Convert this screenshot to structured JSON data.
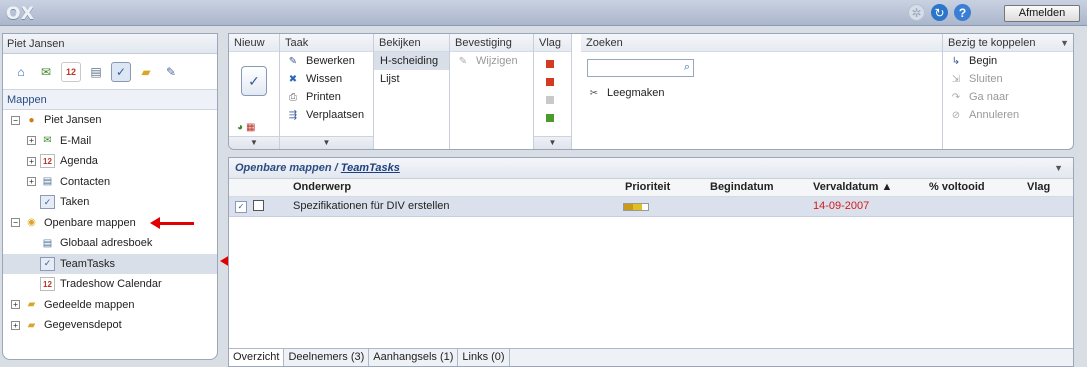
{
  "app": {
    "logo": "OX",
    "logout_label": "Afmelden",
    "user_name": "Piet Jansen"
  },
  "left": {
    "header": "Piet Jansen",
    "modules": [
      "portal-icon",
      "mail-icon",
      "calendar-icon",
      "contacts-icon",
      "tasks-icon",
      "files-icon",
      "notes-icon"
    ],
    "calendar_day": "12",
    "mappen_label": "Mappen",
    "tree": [
      {
        "label": "Piet Jansen",
        "expander": "−",
        "icon": "user-icon",
        "level": 0
      },
      {
        "label": "E-Mail",
        "expander": "+",
        "icon": "mail-folder-icon",
        "level": 1
      },
      {
        "label": "Agenda",
        "expander": "+",
        "icon": "calendar-folder-icon",
        "level": 1
      },
      {
        "label": "Contacten",
        "expander": "+",
        "icon": "contacts-folder-icon",
        "level": 1
      },
      {
        "label": "Taken",
        "expander": "",
        "icon": "tasks-folder-icon",
        "level": 1
      },
      {
        "label": "Openbare mappen",
        "expander": "−",
        "icon": "public-folder-icon",
        "level": 0
      },
      {
        "label": "Globaal adresboek",
        "expander": "",
        "icon": "addressbook-icon",
        "level": 1
      },
      {
        "label": "TeamTasks",
        "expander": "",
        "icon": "tasks-folder-icon",
        "level": 1,
        "selected": true
      },
      {
        "label": "Tradeshow Calendar",
        "expander": "",
        "icon": "calendar-folder-icon",
        "level": 1
      },
      {
        "label": "Gedeelde mappen",
        "expander": "+",
        "icon": "shared-folder-icon",
        "level": 0
      },
      {
        "label": "Gegevensdepot",
        "expander": "+",
        "icon": "storage-folder-icon",
        "level": 0
      }
    ]
  },
  "toolbar": {
    "nieuw": {
      "label": "Nieuw"
    },
    "taak": {
      "label": "Taak",
      "items": [
        "Bewerken",
        "Wissen",
        "Printen",
        "Verplaatsen"
      ]
    },
    "bekijken": {
      "label": "Bekijken",
      "items": [
        "H-scheiding",
        "Lijst"
      ]
    },
    "bevestiging": {
      "label": "Bevestiging",
      "items": [
        "Wijzigen"
      ]
    },
    "vlag": {
      "label": "Vlag",
      "flags": [
        "#d23a22",
        "#d23a22",
        "#c9c9c9",
        "#4a9a2c"
      ]
    },
    "zoeken": {
      "label": "Zoeken",
      "clear": "Leegmaken"
    },
    "koppelen": {
      "label": "Bezig te koppelen",
      "items": [
        "Begin",
        "Sluiten",
        "Ga naar",
        "Annuleren"
      ]
    }
  },
  "main": {
    "crumb_parent": "Openbare mappen",
    "crumb_sep": "/",
    "crumb_current": "TeamTasks",
    "columns": {
      "subject": "Onderwerp",
      "priority": "Prioriteit",
      "start": "Begindatum",
      "due": "Vervaldatum ▲",
      "done": "% voltooid",
      "flag": "Vlag"
    },
    "rows": [
      {
        "subject": "Spezifikationen für DIV erstellen",
        "start": "",
        "due": "14-09-2007",
        "done": "",
        "priority_level": 2
      }
    ],
    "tabs": [
      "Overzicht",
      "Deelnemers (3)",
      "Aanhangsels (1)",
      "Links (0)"
    ]
  },
  "colors": {
    "accent": "#2a4c82",
    "selection": "#dbe1ec",
    "due_red": "#d21a1a",
    "arrow_red": "#e00000"
  }
}
